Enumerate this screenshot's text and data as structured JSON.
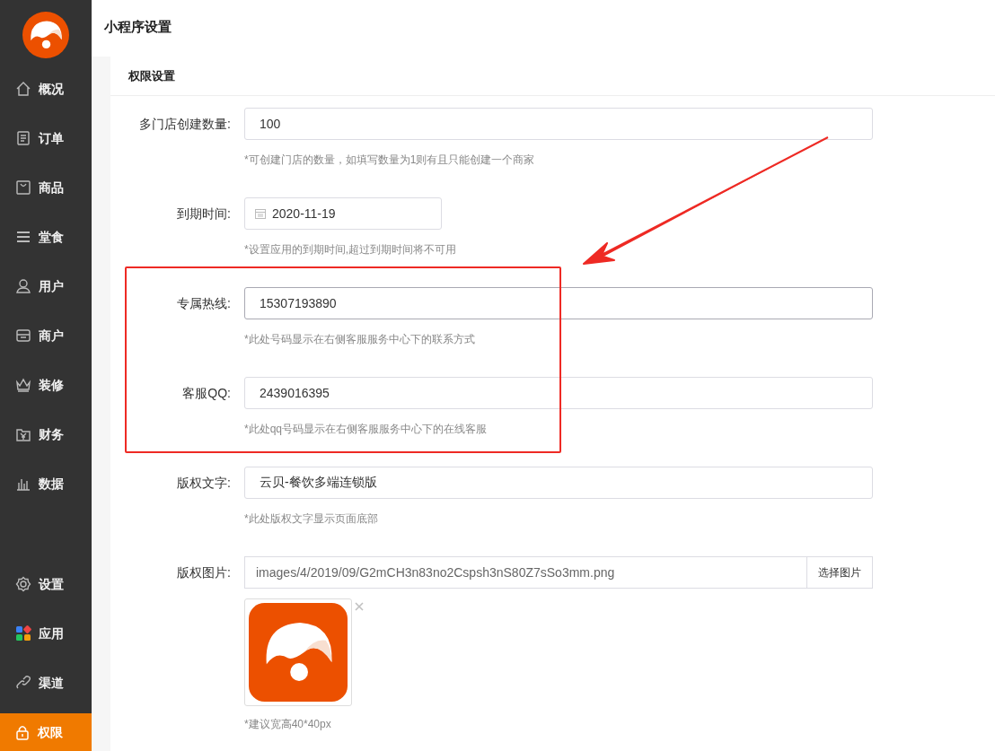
{
  "sidebar": {
    "items": [
      {
        "label": "概况",
        "selected": false
      },
      {
        "label": "订单",
        "selected": false
      },
      {
        "label": "商品",
        "selected": false
      },
      {
        "label": "堂食",
        "selected": false
      },
      {
        "label": "用户",
        "selected": false
      },
      {
        "label": "商户",
        "selected": false
      },
      {
        "label": "装修",
        "selected": false
      },
      {
        "label": "财务",
        "selected": false
      },
      {
        "label": "数据",
        "selected": false
      }
    ],
    "bottom_items": [
      {
        "label": "设置",
        "selected": false
      },
      {
        "label": "应用",
        "selected": false
      },
      {
        "label": "渠道",
        "selected": false
      },
      {
        "label": "权限",
        "selected": true
      }
    ]
  },
  "page_title": "小程序设置",
  "section_title": "权限设置",
  "fields": [
    {
      "kind": "text",
      "label": "多门店创建数量:",
      "value": "100",
      "hint": "*可创建门店的数量，如填写数量为1则有且只能创建一个商家",
      "focused": false
    },
    {
      "kind": "date",
      "label": "到期时间:",
      "value": "2020-11-19",
      "hint": "*设置应用的到期时间,超过到期时间将不可用",
      "focused": false
    },
    {
      "kind": "text",
      "label": "专属热线:",
      "value": "15307193890",
      "hint": "*此处号码显示在右侧客服服务中心下的联系方式",
      "focused": true
    },
    {
      "kind": "text",
      "label": "客服QQ:",
      "value": "2439016395",
      "hint": "*此处qq号码显示在右侧客服服务中心下的在线客服",
      "focused": false
    },
    {
      "kind": "text",
      "label": "版权文字:",
      "value": "云贝-餐饮多端连锁版",
      "hint": "*此处版权文字显示页面底部",
      "focused": false
    },
    {
      "kind": "file",
      "label": "版权图片:",
      "value": "images/4/2019/09/G2mCH3n83no2Cspsh3nS80Z7sSo3mm.png",
      "button": "选择图片",
      "hint": "*建议宽高40*40px",
      "focused": false
    }
  ]
}
